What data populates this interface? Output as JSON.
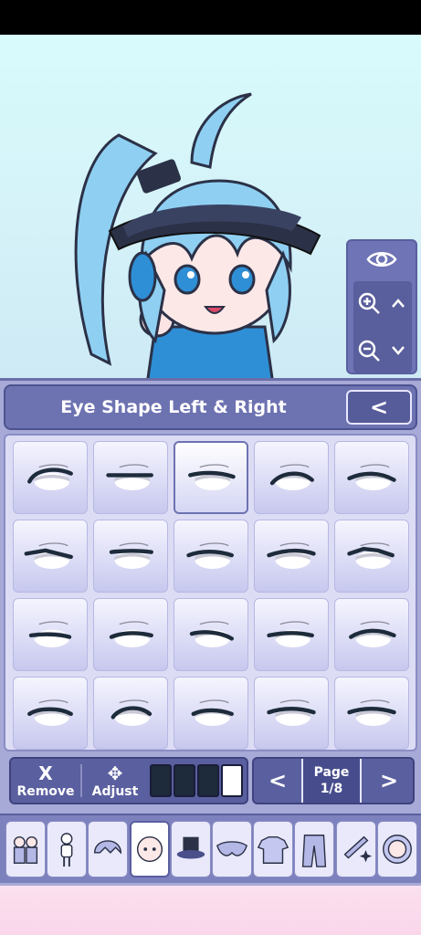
{
  "panel": {
    "title": "Eye Shape Left & Right",
    "back_glyph": "<"
  },
  "eye_grid": {
    "rows": 4,
    "columns": 5,
    "selected_index": 2
  },
  "controls": {
    "remove_glyph": "X",
    "remove_label": "Remove",
    "adjust_glyph": "✥",
    "adjust_label": "Adjust",
    "swatch_colors": [
      "#1d2b3a",
      "#1d2b3a",
      "#1d2b3a",
      "#ffffff"
    ],
    "prev_glyph": "<",
    "next_glyph": ">",
    "page_label": "Page",
    "page_value": "1/8"
  },
  "view_controls": {
    "zoom_in_glyph": "+",
    "zoom_out_glyph": "−",
    "up_glyph": "^",
    "down_glyph": "v"
  },
  "category_tabs": [
    "presets",
    "body",
    "hair",
    "face",
    "hat",
    "mask",
    "top",
    "pants",
    "accessory",
    "profile"
  ],
  "colors": {
    "accent": "#6d72b1",
    "panel_bg": "#a7a9d6",
    "scene_bg": "#d8fbfc",
    "hair": "#8fd0f2",
    "visor": "#2b3147"
  }
}
